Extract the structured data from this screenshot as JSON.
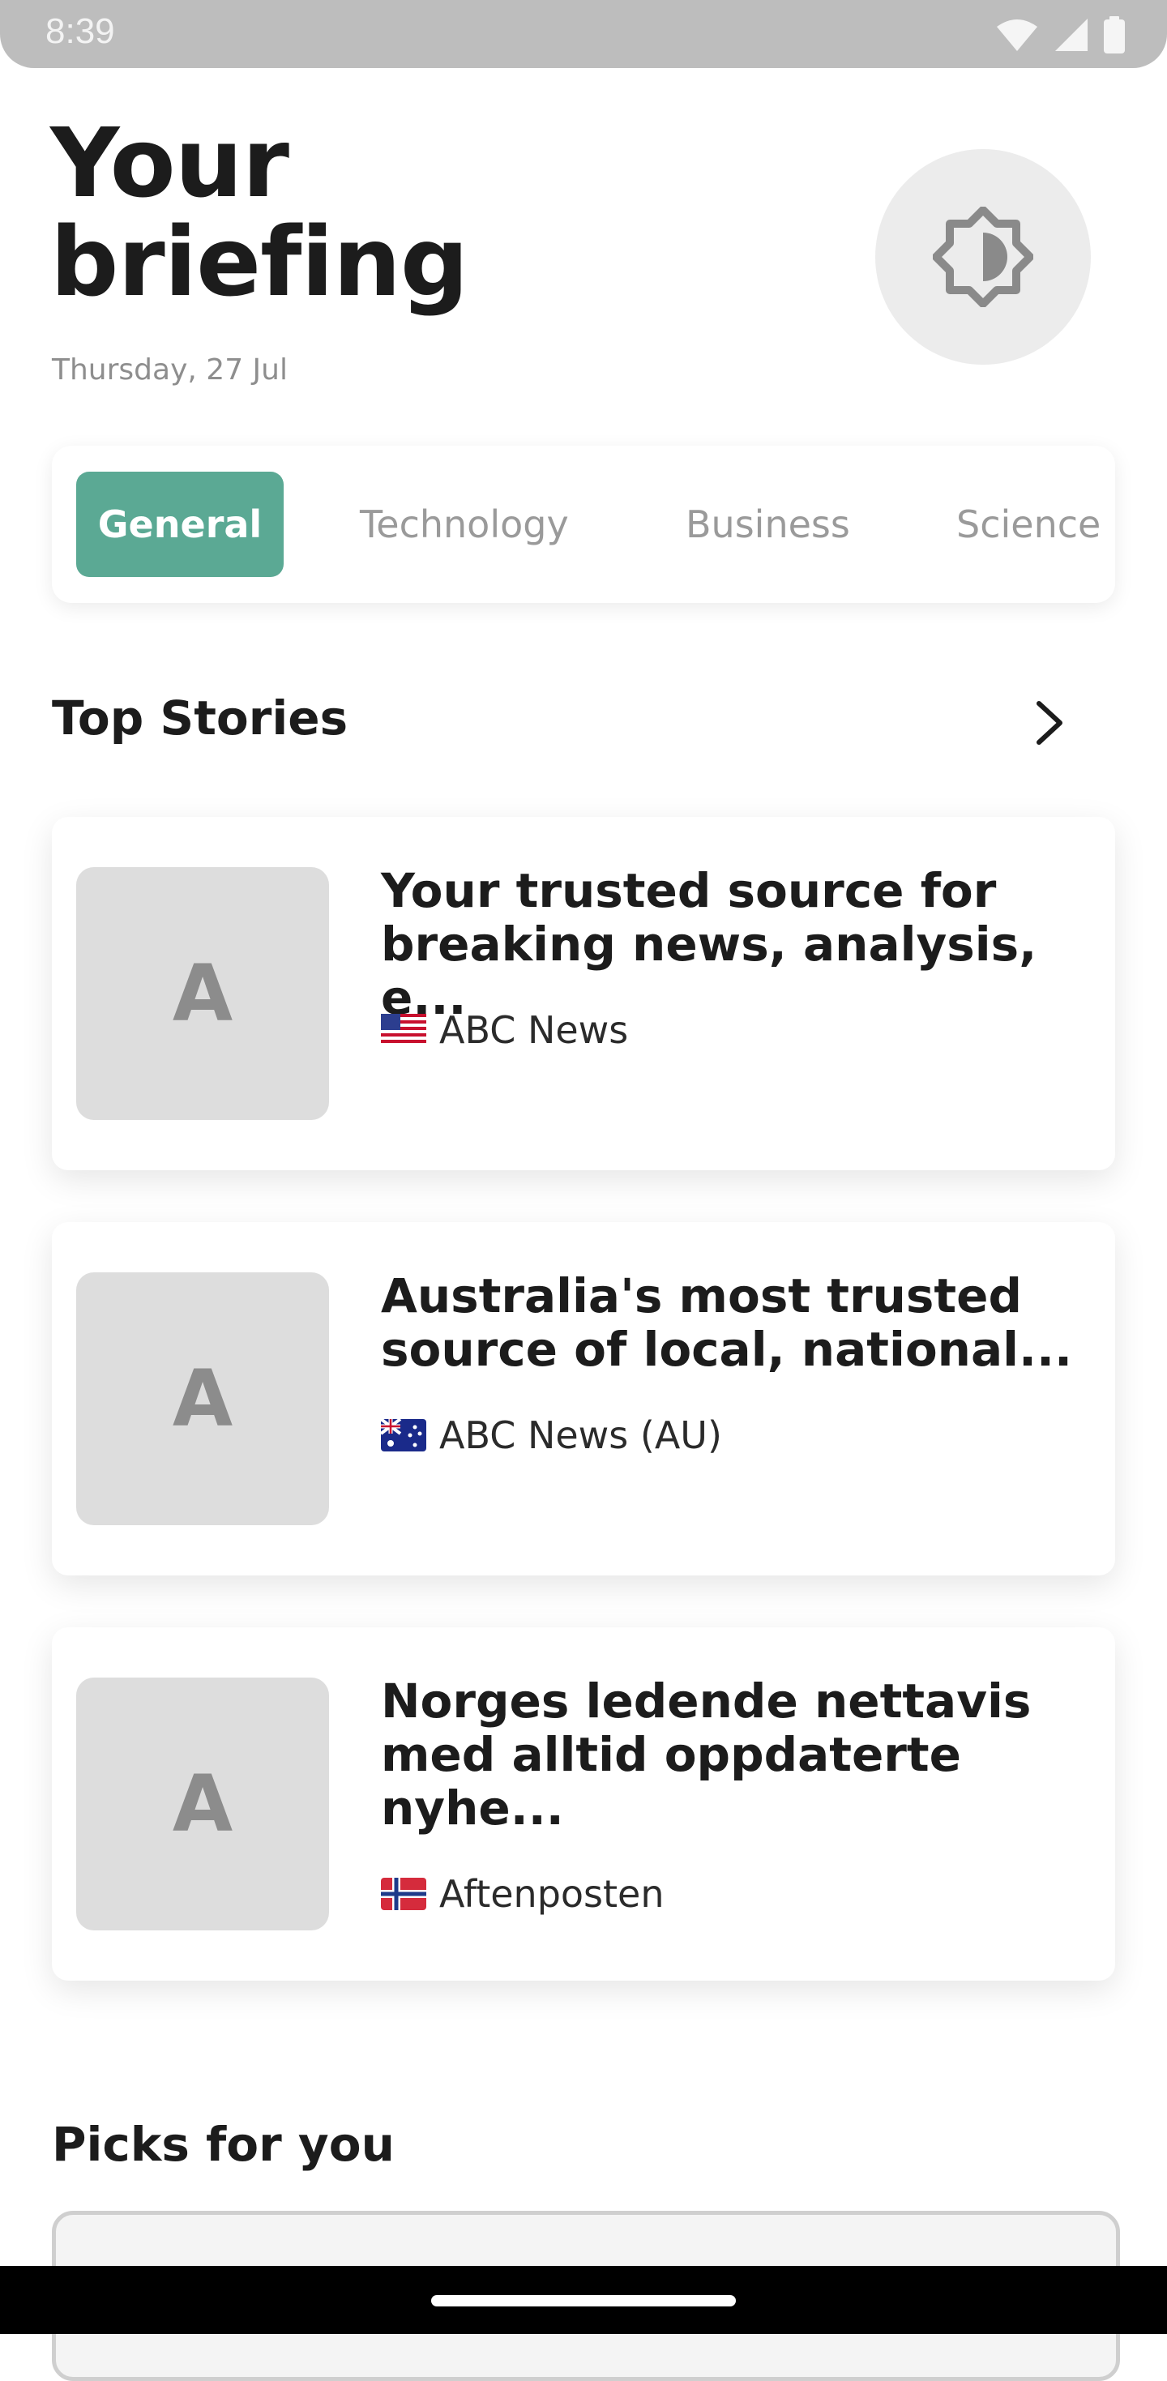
{
  "status_bar": {
    "time": "8:39",
    "icons": [
      "wifi-icon",
      "signal-icon",
      "battery-icon"
    ]
  },
  "header": {
    "title_line1": "Your",
    "title_line2": "briefing",
    "date": "Thursday, 27 Jul",
    "theme_toggle_icon": "brightness-icon"
  },
  "tabs": [
    {
      "label": "General",
      "active": true
    },
    {
      "label": "Technology",
      "active": false
    },
    {
      "label": "Business",
      "active": false
    },
    {
      "label": "Science",
      "active": false
    }
  ],
  "top_stories": {
    "heading": "Top Stories",
    "more_icon": "chevron-right-icon",
    "items": [
      {
        "thumb_letter": "A",
        "title": "Your trusted source for breaking news, analysis, e...",
        "flag": "US",
        "source": "ABC News"
      },
      {
        "thumb_letter": "A",
        "title": "Australia's most trusted source of local, national...",
        "flag": "AU",
        "source": "ABC News (AU)"
      },
      {
        "thumb_letter": "A",
        "title": "Norges ledende nettavis med alltid oppdaterte nyhe...",
        "flag": "NO",
        "source": "Aftenposten"
      }
    ]
  },
  "picks": {
    "heading": "Picks for you"
  },
  "colors": {
    "accent": "#5ba994",
    "status_bar": "#bdbdbd",
    "thumb": "#dddddd"
  }
}
